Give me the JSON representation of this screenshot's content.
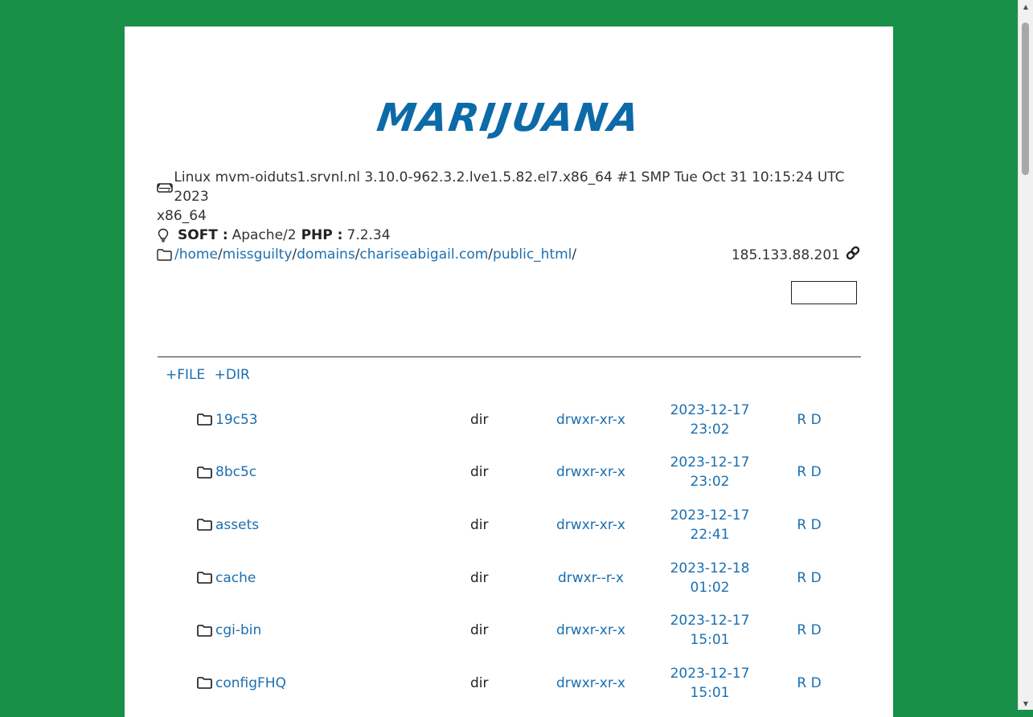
{
  "brand": {
    "logo_text": "MARIJUANA"
  },
  "server": {
    "uname_line1": "Linux mvm-oiduts1.srvnl.nl 3.10.0-962.3.2.lve1.5.82.el7.x86_64 #1 SMP Tue Oct 31 10:15:24 UTC 2023",
    "uname_line2": "x86_64",
    "soft_label": "SOFT :",
    "soft_value": "Apache/2",
    "php_label": "PHP :",
    "php_value": "7.2.34",
    "ip": "185.133.88.201"
  },
  "path": {
    "segments": [
      "/",
      "home",
      "/",
      "missguilty",
      "/",
      "domains",
      "/",
      "chariseabigail.com",
      "/",
      "public_html",
      "/"
    ]
  },
  "actions": {
    "new_file": "+FILE",
    "new_dir": "+DIR"
  },
  "files": [
    {
      "name": "19c53",
      "type": "dir",
      "perm": "drwxr-xr-x",
      "date": "2023-12-17",
      "time": "23:02",
      "r": "R",
      "d": "D"
    },
    {
      "name": "8bc5c",
      "type": "dir",
      "perm": "drwxr-xr-x",
      "date": "2023-12-17",
      "time": "23:02",
      "r": "R",
      "d": "D"
    },
    {
      "name": "assets",
      "type": "dir",
      "perm": "drwxr-xr-x",
      "date": "2023-12-17",
      "time": "22:41",
      "r": "R",
      "d": "D"
    },
    {
      "name": "cache",
      "type": "dir",
      "perm": "drwxr--r-x",
      "date": "2023-12-18",
      "time": "01:02",
      "r": "R",
      "d": "D"
    },
    {
      "name": "cgi-bin",
      "type": "dir",
      "perm": "drwxr-xr-x",
      "date": "2023-12-17",
      "time": "15:01",
      "r": "R",
      "d": "D"
    },
    {
      "name": "configFHQ",
      "type": "dir",
      "perm": "drwxr-xr-x",
      "date": "2023-12-17",
      "time": "15:01",
      "r": "R",
      "d": "D"
    }
  ],
  "colors": {
    "background": "#1a8f47",
    "link": "#1b6fb0",
    "logo": "#0d6aa8"
  }
}
